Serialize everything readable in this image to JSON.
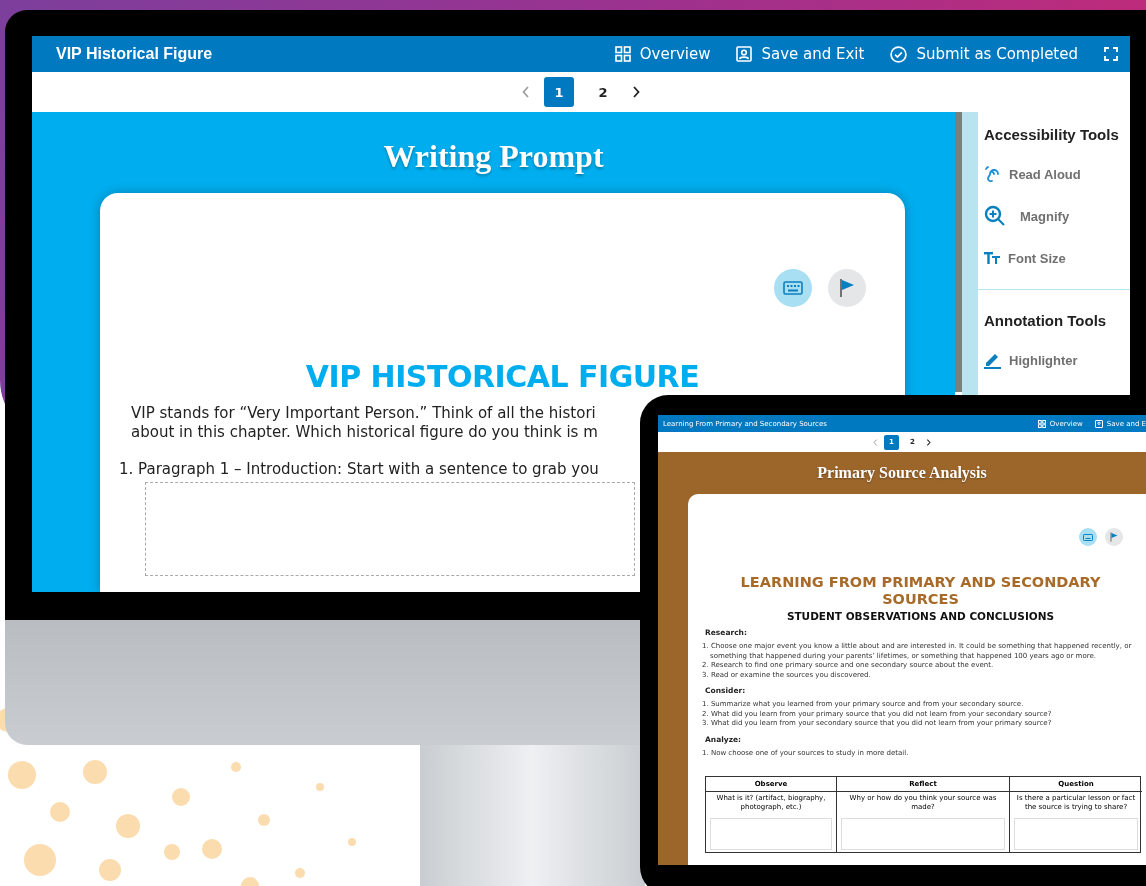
{
  "monitor_screen": {
    "header": {
      "title": "VIP Historical Figure",
      "actions": [
        {
          "label": "Overview"
        },
        {
          "label": "Save and Exit"
        },
        {
          "label": "Submit as Completed"
        }
      ]
    },
    "pager": [
      {
        "label": "1",
        "selected": true
      },
      {
        "label": "2",
        "selected": false
      }
    ],
    "banner_title": "Writing Prompt",
    "worksheet": {
      "title": "VIP HISTORICAL FIGURE",
      "intro_lines": [
        "VIP stands for “Very Important Person.” Think of all the histori",
        "about in this chapter. Which historical figure do you think is m"
      ],
      "questions": [
        "1. Paragraph 1 – Introduction: Start with a sentence to grab you"
      ]
    },
    "sidebar": [
      {
        "title": "Accessibility Tools",
        "items": [
          {
            "label": "Read Aloud"
          },
          {
            "label": "Magnify"
          },
          {
            "label": "Font Size"
          }
        ]
      },
      {
        "title": "Annotation Tools",
        "items": [
          {
            "label": "Highlighter"
          }
        ]
      }
    ]
  },
  "tablet_screen": {
    "header": {
      "title": "Learning From Primary and Secondary Sources",
      "actions": [
        {
          "label": "Overview"
        },
        {
          "label": "Save and E"
        }
      ]
    },
    "pager": [
      {
        "label": "1",
        "selected": true
      },
      {
        "label": "2",
        "selected": false
      }
    ],
    "banner_title": "Primary Source Analysis",
    "worksheet": {
      "title": "LEARNING FROM PRIMARY AND SECONDARY SOURCES",
      "subtitle": "STUDENT OBSERVATIONS AND CONCLUSIONS",
      "sections": [
        {
          "title": "Research:",
          "items": [
            "1. Choose one major event you know a little about and are interested in. It could be something that happened recently, or something that happened during your parents’ lifetimes, or something that happened 100 years ago or more.",
            "2. Research to find one primary source and one secondary source about the event.",
            "3. Read or examine the sources you discovered."
          ]
        },
        {
          "title": "Consider:",
          "items": [
            "1. Summarize what you learned from your primary source and from your secondary source.",
            "2. What did you learn from your primary source that you did not learn from your secondary source?",
            "3. What did you learn from your secondary source that you did not learn from your primary source?"
          ]
        },
        {
          "title": "Analyze:",
          "items": [
            "1. Now choose one of your sources to study in more detail."
          ]
        }
      ],
      "table": {
        "columns": [
          {
            "header": "Observe",
            "prompt": "What is it? (artifact, biography, photograph, etc.)"
          },
          {
            "header": "Reflect",
            "prompt": "Why or how do you think your source was made?"
          },
          {
            "header": "Question",
            "prompt": "Is there a particular lesson or fact the source is trying to share?"
          }
        ]
      }
    }
  }
}
